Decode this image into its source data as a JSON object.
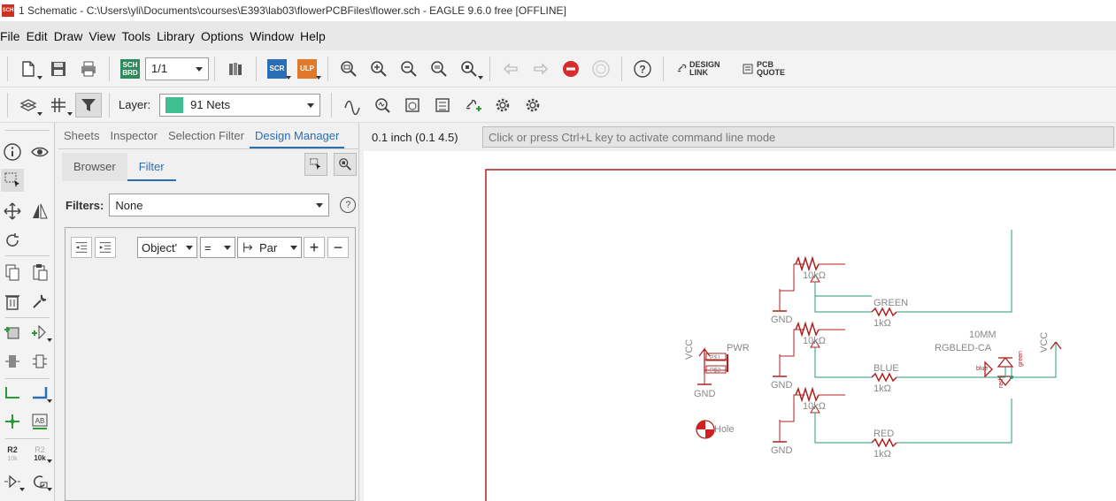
{
  "window": {
    "app_icon_text": "SCH",
    "title": "1 Schematic - C:\\Users\\yli\\Documents\\courses\\E393\\lab03\\flowerPCBFiles\\flower.sch - EAGLE 9.6.0 free [OFFLINE]"
  },
  "menu": [
    "File",
    "Edit",
    "Draw",
    "View",
    "Tools",
    "Library",
    "Options",
    "Window",
    "Help"
  ],
  "toolbar": {
    "sheet_value": "1/1",
    "sch_brd_label": "SCH BRD",
    "scr_label": "SCR",
    "ulp_label": "ULP",
    "help_label": "?",
    "design_link_label": "DESIGN LINK",
    "pcb_quote_label": "PCB QUOTE"
  },
  "layer": {
    "label": "Layer:",
    "value": "91 Nets",
    "color": "#3fbf8f"
  },
  "panel": {
    "tabs": [
      "Sheets",
      "Inspector",
      "Selection Filter",
      "Design Manager"
    ],
    "active_tab": "Design Manager",
    "subtabs": [
      "Browser",
      "Filter"
    ],
    "active_subtab": "Filter",
    "filters_label": "Filters:",
    "filters_value": "None",
    "help_label": "?",
    "object_select": "Object'",
    "op_select": "=",
    "par_select": "Par",
    "plus_label": "+",
    "minus_label": "−"
  },
  "canvas": {
    "coordinate": "0.1 inch (0.1 4.5)",
    "command_placeholder": "Click or press Ctrl+L key to activate command line mode",
    "labels": {
      "pot_value": "10kΩ",
      "gnd": "GND",
      "green": "GREEN",
      "blue": "BLUE",
      "red": "RED",
      "res_value": "1kΩ",
      "vcc": "VCC",
      "pwr": "PWR",
      "p1": "P$1",
      "p2": "P$2",
      "led_value": "10MM",
      "led_name": "RGBLED-CA",
      "blue_small": "blue",
      "green_small": "green",
      "red_small": "red",
      "hole": "Hole"
    }
  },
  "colors": {
    "accent": "#2a6fb5",
    "schematic_red": "#b02020",
    "net_green": "#2a9a73",
    "label_gray": "#888888"
  }
}
